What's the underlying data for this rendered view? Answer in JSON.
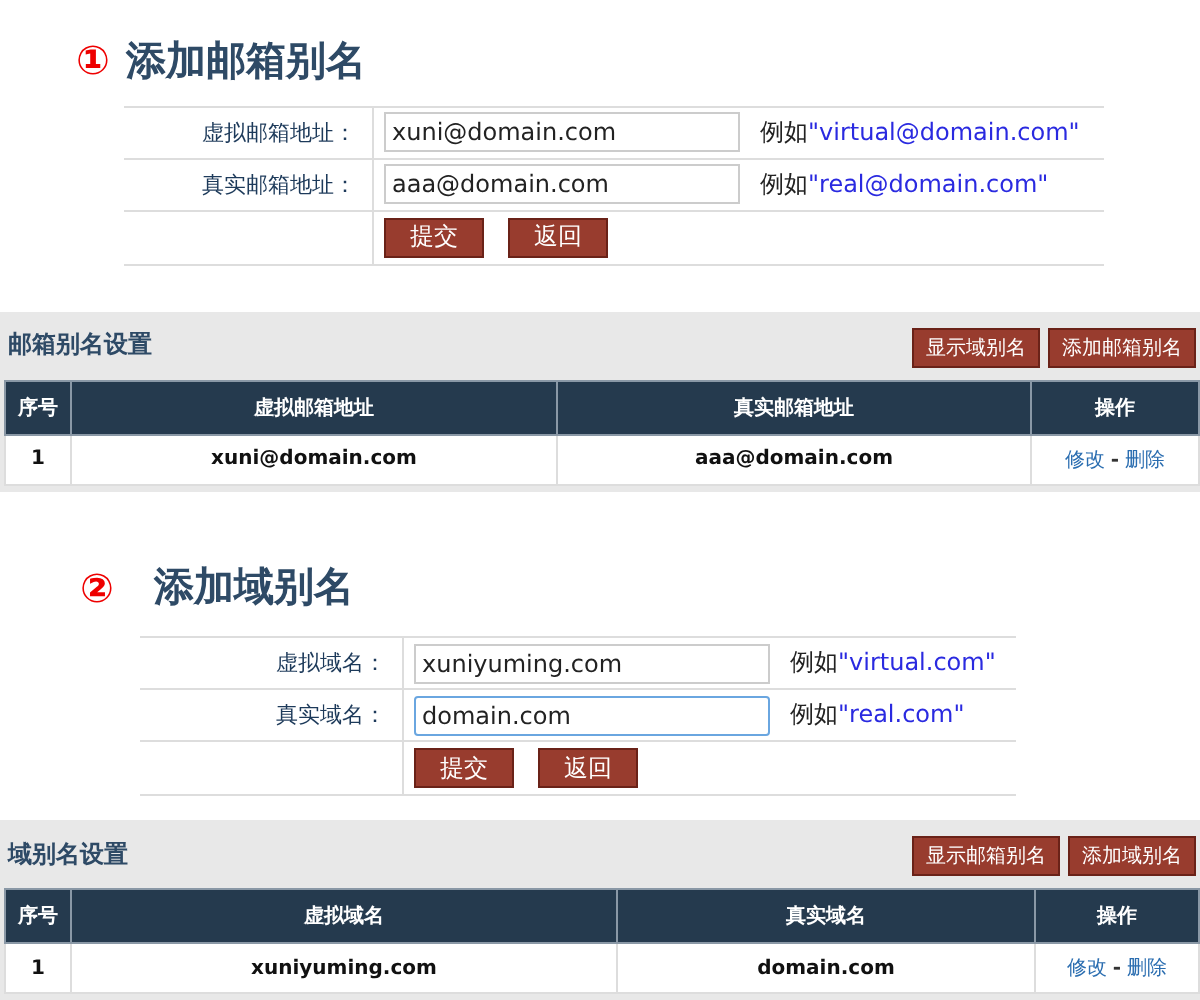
{
  "sections": [
    {
      "number": "①",
      "title": "添加邮箱别名",
      "fields": [
        {
          "label": "虚拟邮箱地址：",
          "value": "xuni@domain.com",
          "focused": false,
          "example_prefix": "例如",
          "example": "\"virtual@domain.com\""
        },
        {
          "label": "真实邮箱地址：",
          "value": "aaa@domain.com",
          "focused": false,
          "example_prefix": "例如",
          "example": "\"real@domain.com\""
        }
      ],
      "buttons": [
        "提交",
        "返回"
      ],
      "panel": {
        "title": "邮箱别名设置",
        "buttons": [
          "显示域别名",
          "添加邮箱别名"
        ],
        "columns": [
          "序号",
          "虚拟邮箱地址",
          "真实邮箱地址",
          "操作"
        ],
        "rows": [
          {
            "index": "1",
            "virtual": "xuni@domain.com",
            "real": "aaa@domain.com",
            "actions": [
              "修改",
              "删除"
            ],
            "separator": "-"
          }
        ]
      }
    },
    {
      "number": "②",
      "title": "添加域别名",
      "fields": [
        {
          "label": "虚拟域名：",
          "value": "xuniyuming.com",
          "focused": false,
          "example_prefix": "例如",
          "example": "\"virtual.com\""
        },
        {
          "label": "真实域名：",
          "value": "domain.com",
          "focused": true,
          "example_prefix": "例如",
          "example": "\"real.com\""
        }
      ],
      "buttons": [
        "提交",
        "返回"
      ],
      "panel": {
        "title": "域别名设置",
        "buttons": [
          "显示邮箱别名",
          "添加域别名"
        ],
        "columns": [
          "序号",
          "虚拟域名",
          "真实域名",
          "操作"
        ],
        "rows": [
          {
            "index": "1",
            "virtual": "xuniyuming.com",
            "real": "domain.com",
            "actions": [
              "修改",
              "删除"
            ],
            "separator": "-"
          }
        ]
      }
    }
  ]
}
